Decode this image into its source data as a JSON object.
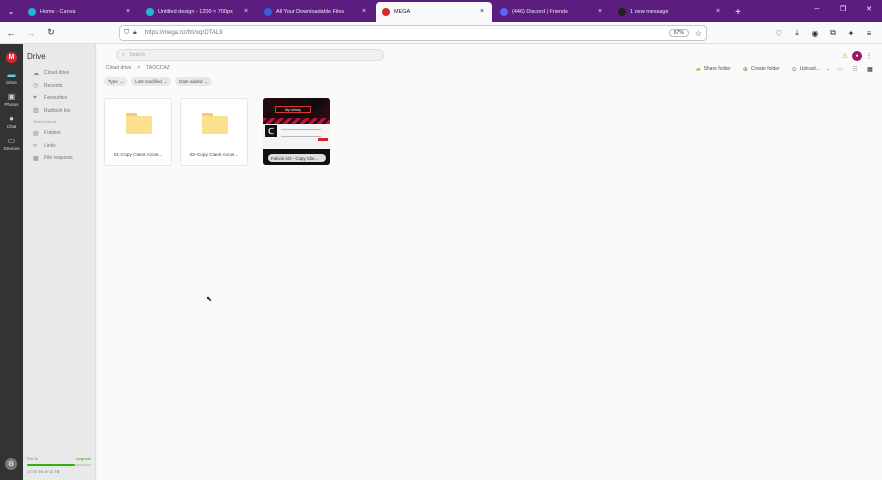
{
  "browser": {
    "tabs": [
      {
        "title": "Home - Canva",
        "icon": "canva-icon",
        "color": "#1fb7d4",
        "active": false
      },
      {
        "title": "Untitled design - 1200 × 700px",
        "icon": "canva-icon",
        "color": "#1fb7d4",
        "active": false
      },
      {
        "title": "All Your Downloadable Files",
        "icon": "xc-icon",
        "color": "#3b5bdb",
        "active": false
      },
      {
        "title": "MEGA",
        "icon": "mega-icon",
        "color": "#d9272e",
        "active": true
      },
      {
        "title": "(446) Discord | Friends",
        "icon": "discord-icon",
        "color": "#5865f2",
        "active": false
      },
      {
        "title": "1 new message",
        "icon": "a-icon",
        "color": "#222222",
        "active": false
      }
    ],
    "url": "https://mega.nz/fm/xqrDTAL9",
    "zoom": "67%"
  },
  "rail": {
    "items": [
      {
        "label": "Drive",
        "icon": "folder-icon",
        "active": true
      },
      {
        "label": "Photos",
        "icon": "image-icon",
        "active": false
      },
      {
        "label": "Chat",
        "icon": "chat-icon",
        "active": false
      },
      {
        "label": "Devices",
        "icon": "monitor-icon",
        "active": false
      }
    ]
  },
  "sidebar": {
    "title": "Drive",
    "items": [
      {
        "label": "Cloud drive",
        "icon": "cloud-icon"
      },
      {
        "label": "Recents",
        "icon": "clock-icon"
      },
      {
        "label": "Favourites",
        "icon": "heart-icon"
      },
      {
        "label": "Rubbish bin",
        "icon": "trash-icon"
      }
    ],
    "section": "Shared items",
    "shared_items": [
      {
        "label": "Folders",
        "icon": "shared-folder-icon"
      },
      {
        "label": "Links",
        "icon": "link-icon"
      },
      {
        "label": "File requests",
        "icon": "file-request-icon"
      }
    ],
    "storage": {
      "plan": "Pro III",
      "upgrade": "Upgrade",
      "used": "17.95 TB of 16 TB",
      "fraction": 0.75
    }
  },
  "main": {
    "search_placeholder": "Search",
    "breadcrumb": [
      "Cloud drive",
      ">",
      "TAOCCAZ"
    ],
    "actions": {
      "share": "Share folder",
      "create": "Create folder",
      "upload": "Upload..."
    },
    "filters": [
      {
        "label": "Type"
      },
      {
        "label": "Last modified"
      },
      {
        "label": "Date added"
      }
    ],
    "items": [
      {
        "name": "01-Copy Client Accel...",
        "kind": "folder"
      },
      {
        "name": "02-Copy Client Accel...",
        "kind": "folder"
      },
      {
        "name": "Falcon AO - Copy Clie...",
        "kind": "image",
        "thumb_button": "My Library"
      }
    ]
  }
}
